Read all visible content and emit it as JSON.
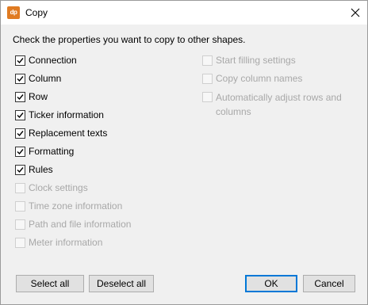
{
  "window": {
    "title": "Copy",
    "icon_text": "dp",
    "accent": "#e07b22"
  },
  "instruction": "Check the properties you want to copy to other shapes.",
  "left_options": [
    {
      "label": "Connection",
      "checked": true,
      "enabled": true
    },
    {
      "label": "Column",
      "checked": true,
      "enabled": true
    },
    {
      "label": "Row",
      "checked": true,
      "enabled": true
    },
    {
      "label": "Ticker information",
      "checked": true,
      "enabled": true
    },
    {
      "label": "Replacement texts",
      "checked": true,
      "enabled": true
    },
    {
      "label": "Formatting",
      "checked": true,
      "enabled": true
    },
    {
      "label": "Rules",
      "checked": true,
      "enabled": true
    },
    {
      "label": "Clock settings",
      "checked": false,
      "enabled": false
    },
    {
      "label": "Time zone information",
      "checked": false,
      "enabled": false
    },
    {
      "label": "Path and file information",
      "checked": false,
      "enabled": false
    },
    {
      "label": "Meter information",
      "checked": false,
      "enabled": false
    }
  ],
  "right_options": [
    {
      "label": "Start filling settings",
      "checked": false,
      "enabled": false
    },
    {
      "label": "Copy column names",
      "checked": false,
      "enabled": false
    },
    {
      "label": "Automatically adjust rows and columns",
      "checked": false,
      "enabled": false
    }
  ],
  "buttons": {
    "select_all": "Select all",
    "deselect_all": "Deselect all",
    "ok": "OK",
    "cancel": "Cancel"
  }
}
